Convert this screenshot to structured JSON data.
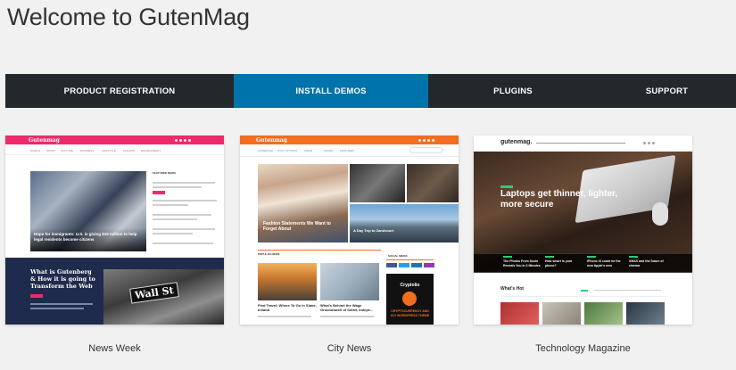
{
  "page_title": "Welcome to GutenMag",
  "tabs": [
    {
      "label": "PRODUCT REGISTRATION",
      "active": false
    },
    {
      "label": "INSTALL DEMOS",
      "active": true
    },
    {
      "label": "PLUGINS",
      "active": false
    },
    {
      "label": "SUPPORT",
      "active": false
    }
  ],
  "colors": {
    "tab_bar": "#23282d",
    "tab_active": "#0073aa",
    "news_week_accent": "#f0296a",
    "city_news_accent": "#f36d1f",
    "tech_accent": "#2ecc71"
  },
  "demos": [
    {
      "name": "News Week",
      "preview": {
        "logo": "Gutenmag",
        "nav": [
          "WORLD",
          "SPORT",
          "CULTURE",
          "BUSINESS",
          "LIFESTYLE",
          "FASHION",
          "ENVIRONMENT"
        ],
        "sidebar_heading": "FEATURED NEWS",
        "hero_caption": "Hope for immigrants: U.S. is giving $10 million to help legal residents become citizens",
        "bottom_title": "What is Gutenberg & How it is going to Transform the Web",
        "sign_text": "Wall St"
      }
    },
    {
      "name": "City News",
      "preview": {
        "logo": "Gutenmag",
        "nav": [
          "HOMEPAGE",
          "POST OPTIONS",
          "WEAR",
          "SHOES",
          "FEATURES"
        ],
        "hero_caption": "Fashion Statements We Want to Forget About",
        "side_caption": "A Day Trip to Zandvoort",
        "section_heading": "POPULAR NEWS",
        "card1": "Find Travel: Where To Go In Slane, Ireland",
        "card2": "What's Behind the Wage Groundswell of Small, Indepe...",
        "social_heading": "SOCIAL MEDIA",
        "widget_title": "Cryptolio",
        "widget_text": "CRYPTOCURRENCY AND ICO WORDPRESS THEME"
      }
    },
    {
      "name": "Technology Magazine",
      "preview": {
        "logo": "gutenmag.",
        "hero_title": "Laptops get thinner, lighter, more secure",
        "strip_items": [
          "The Photos From Sochi Reveals You in 3 Minutes",
          "How smart is your phone?",
          "iPhone XI could be the new Apple's new",
          "XMAX and the future of cinema"
        ],
        "section_heading": "What's Hot"
      }
    }
  ]
}
